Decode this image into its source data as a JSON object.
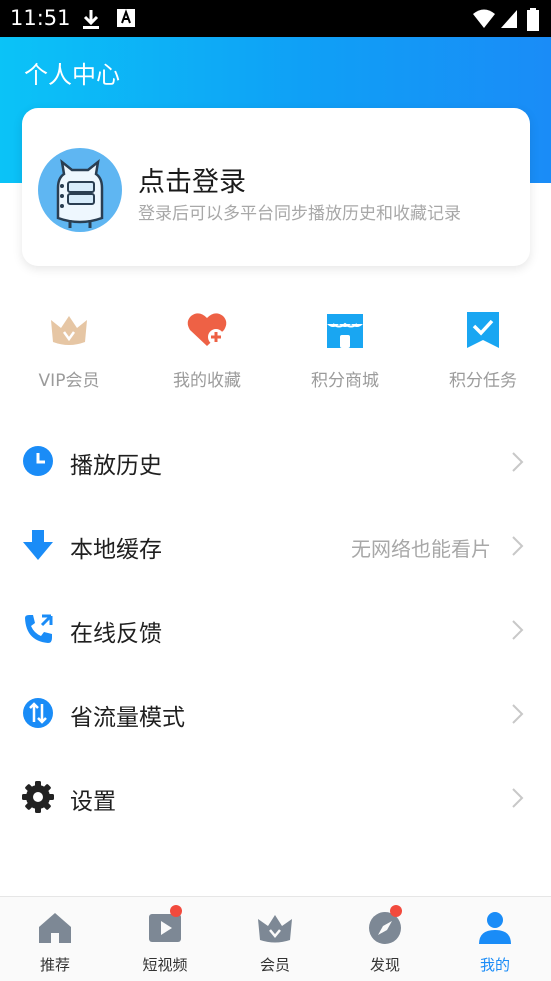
{
  "status_bar": {
    "time": "11:51"
  },
  "header": {
    "title": "个人中心"
  },
  "login_card": {
    "title": "点击登录",
    "subtitle": "登录后可以多平台同步播放历史和收藏记录"
  },
  "quick_actions": [
    {
      "label": "VIP会员",
      "icon": "crown-icon"
    },
    {
      "label": "我的收藏",
      "icon": "heart-plus-icon"
    },
    {
      "label": "积分商城",
      "icon": "store-icon"
    },
    {
      "label": "积分任务",
      "icon": "task-check-icon"
    }
  ],
  "menu": [
    {
      "label": "播放历史",
      "hint": "",
      "icon": "clock-icon"
    },
    {
      "label": "本地缓存",
      "hint": "无网络也能看片",
      "icon": "download-icon"
    },
    {
      "label": "在线反馈",
      "hint": "",
      "icon": "phone-icon"
    },
    {
      "label": "省流量模式",
      "hint": "",
      "icon": "data-saver-icon"
    },
    {
      "label": "设置",
      "hint": "",
      "icon": "gear-icon"
    }
  ],
  "bottom_nav": [
    {
      "label": "推荐",
      "icon": "home-icon",
      "badge": false
    },
    {
      "label": "短视频",
      "icon": "video-icon",
      "badge": true
    },
    {
      "label": "会员",
      "icon": "crown-icon",
      "badge": false
    },
    {
      "label": "发现",
      "icon": "compass-icon",
      "badge": true
    },
    {
      "label": "我的",
      "icon": "person-icon",
      "badge": false,
      "active": true
    }
  ],
  "colors": {
    "brand_blue": "#1a8cf7",
    "header_gradient_start": "#0bc3f7",
    "badge_red": "#f24a3d",
    "muted_text": "#a8a8a8"
  }
}
